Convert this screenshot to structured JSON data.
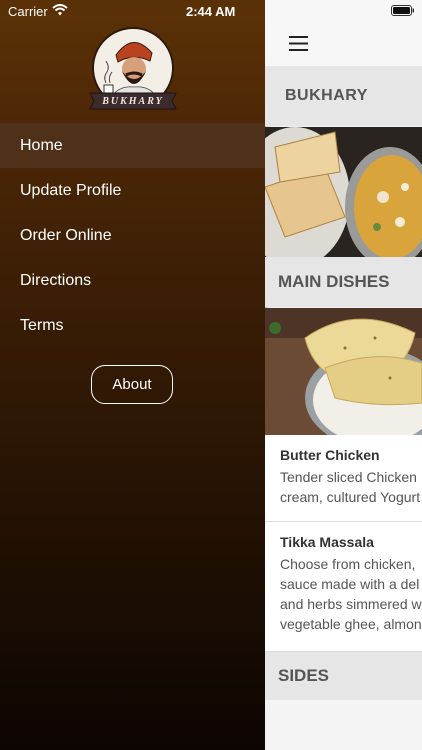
{
  "status": {
    "carrier": "Carrier",
    "time": "2:44 AM"
  },
  "drawer": {
    "logo_text": "BUKHARY",
    "menu": [
      {
        "label": "Home",
        "active": true
      },
      {
        "label": "Update Profile"
      },
      {
        "label": "Order Online"
      },
      {
        "label": "Directions"
      },
      {
        "label": "Terms"
      }
    ],
    "about_label": "About"
  },
  "main": {
    "header_title": "BUKHARY",
    "sections": {
      "main_dishes": "MAIN DISHES",
      "sides": "SIDES"
    },
    "dishes": [
      {
        "title": "Butter Chicken",
        "desc": [
          "Tender sliced Chicken",
          "cream, cultured Yogurt"
        ]
      },
      {
        "title": "Tikka Massala",
        "desc": [
          "Choose from chicken,",
          "sauce made with a del",
          "and herbs simmered w",
          "vegetable ghee, almon"
        ]
      }
    ]
  },
  "icons": [
    "wifi-icon",
    "battery-icon",
    "hamburger-icon"
  ],
  "colors": {
    "drawer_top": "#5c3106",
    "drawer_bottom": "#0c0502",
    "active_item": "#4e3118",
    "section_bg": "#e6e6e6"
  }
}
